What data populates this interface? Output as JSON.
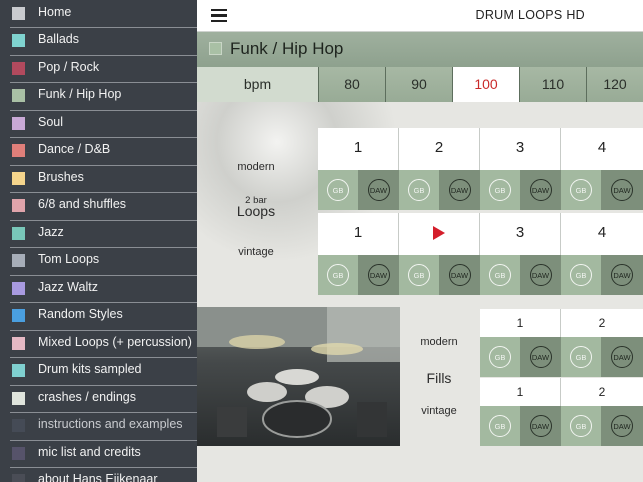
{
  "sidebar": {
    "items": [
      {
        "label": "Home",
        "color": "#c9cbcf"
      },
      {
        "label": "Ballads",
        "color": "#7fd3d0"
      },
      {
        "label": "Pop / Rock",
        "color": "#b24a5e"
      },
      {
        "label": "Funk / Hip Hop",
        "color": "#a9c0a5"
      },
      {
        "label": "Soul",
        "color": "#c9a9d6"
      },
      {
        "label": "Dance / D&B",
        "color": "#e07f7a"
      },
      {
        "label": "Brushes",
        "color": "#f5d58c"
      },
      {
        "label": "6/8 and shuffles",
        "color": "#e0a4ab"
      },
      {
        "label": "Jazz",
        "color": "#79c7b9"
      },
      {
        "label": "Tom Loops",
        "color": "#a6adb8"
      },
      {
        "label": "Jazz Waltz",
        "color": "#a89ae0"
      },
      {
        "label": "Random Styles",
        "color": "#4a9fe0"
      },
      {
        "label": "Mixed Loops (+ percussion)",
        "color": "#e5b9c4"
      },
      {
        "label": "Drum kits sampled",
        "color": "#7fd0d0"
      },
      {
        "label": "crashes / endings",
        "color": "#dfe4dc"
      },
      {
        "label": "instructions and examples",
        "color": "#454b56"
      },
      {
        "label": "mic list and credits",
        "color": "#56536a"
      },
      {
        "label": "about Hans Eijkenaar",
        "color": "#4a4d56"
      }
    ]
  },
  "header": {
    "title": "DRUM LOOPS HD",
    "menu_icon": "hamburger-icon"
  },
  "genre": {
    "title": "Funk / Hip Hop",
    "color": "#a9c0a5"
  },
  "bpm": {
    "label": "bpm",
    "values": [
      "80",
      "90",
      "100",
      "110",
      "120"
    ],
    "selected": "100"
  },
  "loops": {
    "section_label_small": "2 bar",
    "section_label": "Loops",
    "rows": [
      {
        "label": "modern",
        "cells": [
          "1",
          "2",
          "3",
          "4"
        ]
      },
      {
        "label": "vintage",
        "cells": [
          "1",
          "",
          "3",
          "4"
        ],
        "playing_index": 1
      }
    ],
    "gb_label": "GB",
    "daw_label": "DAW"
  },
  "fills": {
    "section_label": "Fills",
    "rows": [
      {
        "label": "modern",
        "cells": [
          "1",
          "2"
        ]
      },
      {
        "label": "vintage",
        "cells": [
          "1",
          "2"
        ]
      }
    ]
  },
  "colors": {
    "accent_red": "#c92a2a",
    "play_red": "#d41e2b",
    "button_light": "#a3b9a0",
    "button_dark": "#7d8f7b"
  }
}
